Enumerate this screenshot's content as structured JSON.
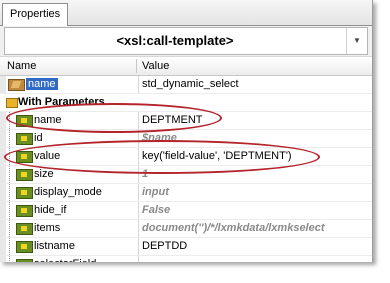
{
  "panel": {
    "tab_label": "Properties"
  },
  "selector": {
    "value": "<xsl:call-template>",
    "arrow": "▼"
  },
  "columns": {
    "name": "Name",
    "value": "Value"
  },
  "rows": [
    {
      "name": "name",
      "value": "std_dynamic_select",
      "kind": "attr-selected",
      "icon": "readonly-attribute-icon"
    },
    {
      "name": "With Parameters",
      "value": "",
      "kind": "group",
      "icon": "folder-icon"
    },
    {
      "name": "name",
      "value": "DEPTMENT",
      "kind": "param",
      "icon": "parameter-icon"
    },
    {
      "name": "id",
      "value": "$name",
      "kind": "param-default",
      "icon": "parameter-icon"
    },
    {
      "name": "value",
      "value": "key('field-value', 'DEPTMENT')",
      "kind": "param",
      "icon": "parameter-icon"
    },
    {
      "name": "size",
      "value": "1",
      "kind": "param-default",
      "icon": "parameter-icon"
    },
    {
      "name": "display_mode",
      "value": "input",
      "kind": "param-default",
      "icon": "parameter-icon"
    },
    {
      "name": "hide_if",
      "value": "False",
      "kind": "param-default",
      "icon": "parameter-icon"
    },
    {
      "name": "items",
      "value": "document('')/*/lxmkdata/lxmkselect",
      "kind": "param-default",
      "icon": "parameter-icon"
    },
    {
      "name": "listname",
      "value": "DEPTDD",
      "kind": "param",
      "icon": "parameter-icon"
    },
    {
      "name": "selectorField",
      "value": "",
      "kind": "param",
      "icon": "parameter-icon"
    }
  ],
  "highlight_color": "#b3242b"
}
